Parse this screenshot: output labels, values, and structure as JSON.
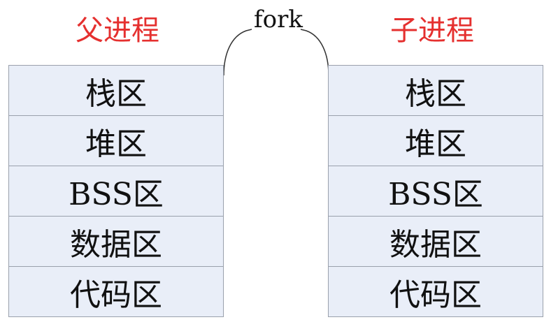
{
  "parent": {
    "title": "父进程",
    "segments": [
      "栈区",
      "堆区",
      "BSS区",
      "数据区",
      "代码区"
    ]
  },
  "child": {
    "title": "子进程",
    "segments": [
      "栈区",
      "堆区",
      "BSS区",
      "数据区",
      "代码区"
    ]
  },
  "fork_label": "fork",
  "colors": {
    "title": "#e5302f",
    "segment_fill": "#e9eef8",
    "segment_border": "#9aa0ac",
    "text": "#111111"
  }
}
